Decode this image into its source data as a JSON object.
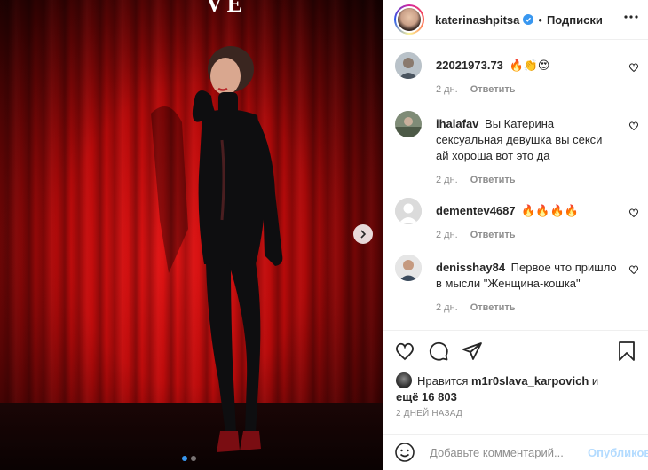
{
  "photo": {
    "sign_text": "VE",
    "pagination": {
      "current": 1,
      "total": 2
    }
  },
  "post": {
    "username": "katerinashpitsa",
    "separator": "•",
    "follow_label": "Подписки"
  },
  "comments": [
    {
      "user": "22021973.73",
      "text": "🔥👏😍",
      "time": "2 дн.",
      "reply": "Ответить"
    },
    {
      "user": "ihalafav",
      "text": "Вы Катерина сексуальная девушка вы секси ай хороша вот это да",
      "time": "2 дн.",
      "reply": "Ответить"
    },
    {
      "user": "dementev4687",
      "text": "🔥🔥🔥🔥",
      "time": "2 дн.",
      "reply": "Ответить"
    },
    {
      "user": "denisshay84",
      "text": "Первое что пришло в мысли \"Женщина-кошка\"",
      "time": "2 дн.",
      "reply": "Ответить"
    }
  ],
  "likes": {
    "prefix": "Нравится",
    "user": "m1r0slava_karpovich",
    "and": "и",
    "more": "ещё 16 803"
  },
  "timestamp": "2 дней назад",
  "composer": {
    "placeholder": "Добавьте комментарий...",
    "publish_label": "Опубликовать"
  },
  "colors": {
    "accent": "#3897f0",
    "publish_disabled": "#b3dbff",
    "muted": "#8e8e8e",
    "text": "#262626"
  }
}
